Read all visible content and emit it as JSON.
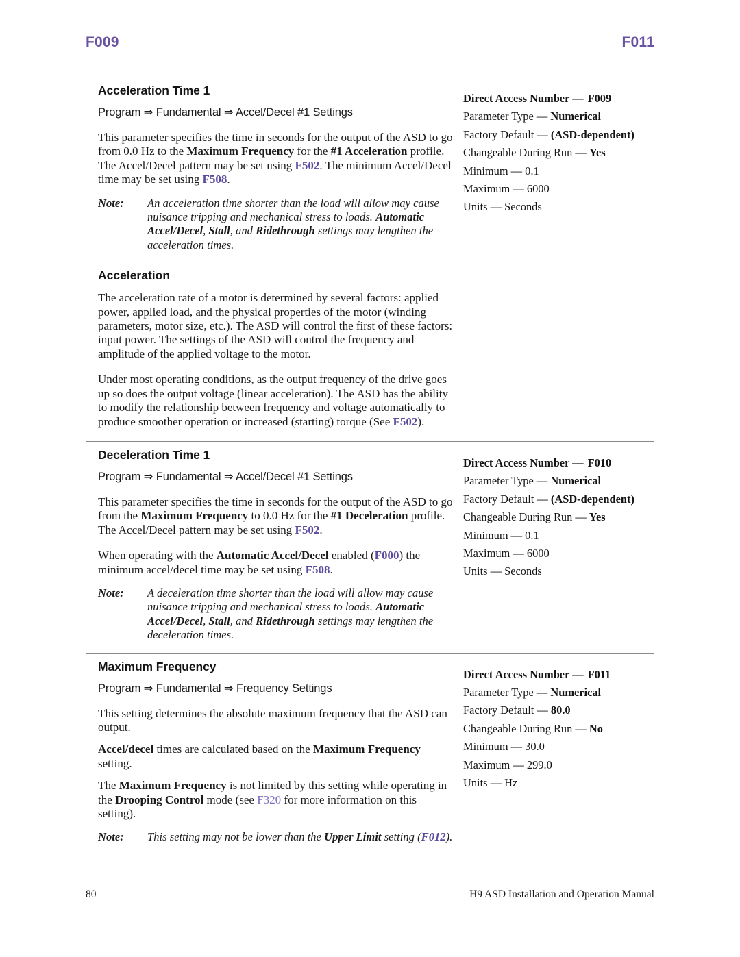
{
  "runhead": {
    "left": "F009",
    "right": "F011",
    "color": "#6a52a3"
  },
  "sections": [
    {
      "id": "acceleration-time-1",
      "title": "Acceleration Time 1",
      "breadcrumb": "Program ⇒ Fundamental ⇒ Accel/Decel #1 Settings",
      "paragraphs": [
        "This parameter specifies the time in seconds for the output of the ASD to go from 0.0 Hz to the Maximum Frequency for the #1 Acceleration profile. The Accel/Decel pattern may be set using F502. The minimum Accel/Decel time may be set using F508."
      ],
      "note_label": "Note:",
      "note_text": "An acceleration time shorter than the load will allow may cause nuisance tripping and mechanical stress to loads. Automatic Accel/Decel, Stall, and Ridethrough settings may lengthen the acceleration times.",
      "spec": {
        "direct_access_label": "Direct Access Number —",
        "direct_access_value": "F009",
        "parameter_type_label": "Parameter Type —",
        "parameter_type_value": "Numerical",
        "factory_default_label": "Factory Default —",
        "factory_default_value": "(ASD-dependent)",
        "changeable_label": "Changeable During Run —",
        "changeable_value": "Yes",
        "minimum_label": "Minimum —",
        "minimum_value": "0.1",
        "maximum_label": "Maximum —",
        "maximum_value": "6000",
        "units_label": "Units —",
        "units_value": "Seconds"
      }
    },
    {
      "id": "deceleration-time-1",
      "title": "Deceleration Time 1",
      "breadcrumb": "Program ⇒ Fundamental ⇒ Accel/Decel #1 Settings",
      "paragraphs": [
        "This parameter specifies the time in seconds for the output of the ASD to go from the Maximum Frequency to 0.0 Hz for the #1 Deceleration profile. The Accel/Decel pattern may be set using F502.",
        "When operating with the Automatic Accel/Decel enabled (F000) the minimum accel/decel time may be set using F508."
      ],
      "note_label": "Note:",
      "note_text": "A deceleration time shorter than the load will allow may cause nuisance tripping and mechanical stress to loads. Automatic Accel/Decel, Stall, and Ridethrough settings may lengthen the deceleration times.",
      "spec": {
        "direct_access_label": "Direct Access Number —",
        "direct_access_value": "F010",
        "parameter_type_label": "Parameter Type —",
        "parameter_type_value": "Numerical",
        "factory_default_label": "Factory Default —",
        "factory_default_value": "(ASD-dependent)",
        "changeable_label": "Changeable During Run —",
        "changeable_value": "Yes",
        "minimum_label": "Minimum —",
        "minimum_value": "0.1",
        "maximum_label": "Maximum —",
        "maximum_value": "6000",
        "units_label": "Units —",
        "units_value": "Seconds"
      }
    },
    {
      "id": "maximum-frequency",
      "title": "Maximum Frequency",
      "breadcrumb": "Program ⇒ Fundamental ⇒ Frequency Settings",
      "paragraphs": [
        "This setting determines the absolute maximum frequency that the ASD can output.",
        "Accel/decel times are calculated based on the Maximum Frequency setting.",
        "The Maximum Frequency is not limited by this setting while operating in the Drooping Control mode (see F320 for more information on this setting)."
      ],
      "note_label": "Note:",
      "note_text": "This setting may not be lower than the Upper Limit setting (F012).",
      "spec": {
        "direct_access_label": "Direct Access Number —",
        "direct_access_value": "F011",
        "parameter_type_label": "Parameter Type —",
        "parameter_type_value": "Numerical",
        "factory_default_label": "Factory Default —",
        "factory_default_value": "80.0",
        "changeable_label": "Changeable During Run —",
        "changeable_value": "No",
        "minimum_label": "Minimum —",
        "minimum_value": "30.0",
        "maximum_label": "Maximum —",
        "maximum_value": "299.0",
        "units_label": "Units —",
        "units_value": "Hz"
      }
    }
  ],
  "subsection_acceleration": {
    "title": "Acceleration",
    "paragraphs": [
      "The acceleration rate of a motor is determined by several factors: applied power, applied load, and the physical properties of the motor (winding parameters, motor size, etc.). The ASD will control the first of these factors: input power. The settings of the ASD will control the frequency and amplitude of the applied voltage to the motor.",
      "Under most operating conditions, as the output frequency of the drive goes up so does the output voltage (linear acceleration). The ASD has the ability to modify the relationship between frequency and voltage automatically to produce smoother operation or increased (starting) torque (See F502)."
    ]
  },
  "footer": {
    "page_number": "80",
    "manual_title": "H9 ASD Installation and Operation Manual"
  },
  "colors": {
    "reference_link": "#5b4a9e",
    "reference_link_plain": "#7d6bbd",
    "running_head": "#6a52a3",
    "rule": "#8a8a8a",
    "text": "#1b1b1b"
  }
}
